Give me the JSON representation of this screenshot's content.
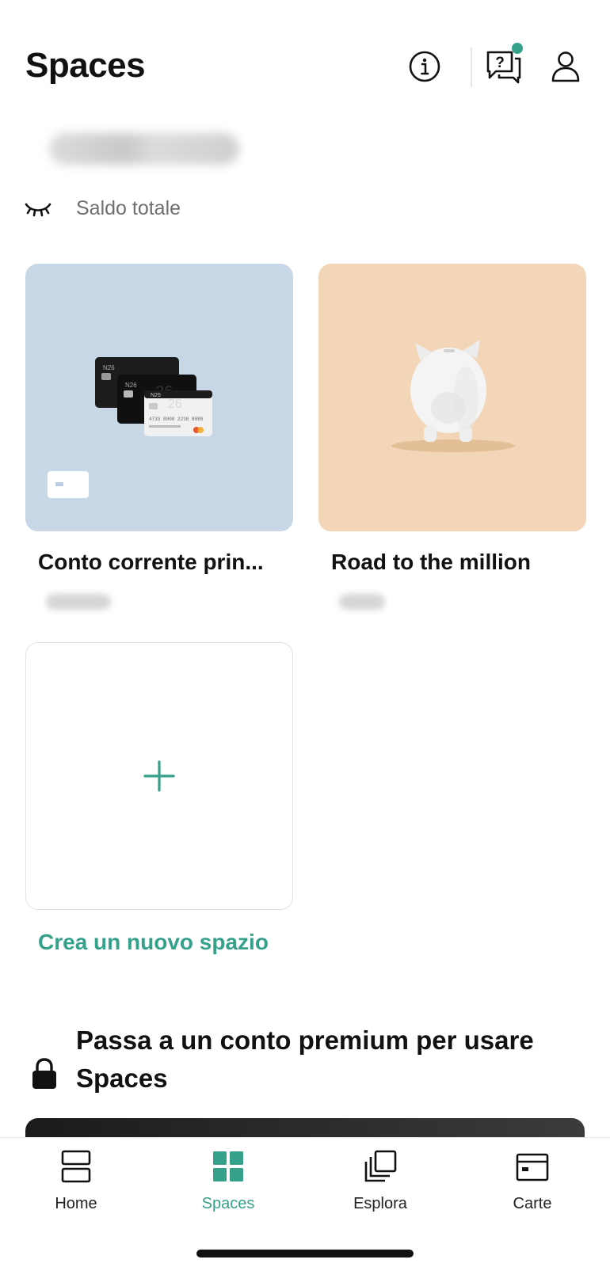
{
  "header": {
    "title": "Spaces",
    "icons": [
      "info-icon",
      "help-chat-icon",
      "profile-icon"
    ],
    "notification_color": "#36a18b"
  },
  "balance": {
    "label": "Saldo totale",
    "amount_hidden": true
  },
  "spaces": [
    {
      "title": "Conto corrente prin...",
      "color": "#c8d7e6",
      "image": "bank-cards-illustration"
    },
    {
      "title": "Road to the million",
      "color": "#f2d6b7",
      "image": "piggy-bank-illustration"
    }
  ],
  "new_space": {
    "label": "Crea un nuovo spazio",
    "icon": "plus-icon"
  },
  "premium": {
    "text": "Passa a un conto premium per usare Spaces",
    "icon": "lock-icon"
  },
  "tabbar": {
    "tabs": [
      {
        "label": "Home",
        "icon": "home-icon",
        "active": false
      },
      {
        "label": "Spaces",
        "icon": "spaces-grid-icon",
        "active": true
      },
      {
        "label": "Esplora",
        "icon": "explore-icon",
        "active": false
      },
      {
        "label": "Carte",
        "icon": "card-icon",
        "active": false
      }
    ]
  },
  "colors": {
    "accent": "#36a18b",
    "text": "#111111",
    "muted": "#6f6f6f"
  }
}
